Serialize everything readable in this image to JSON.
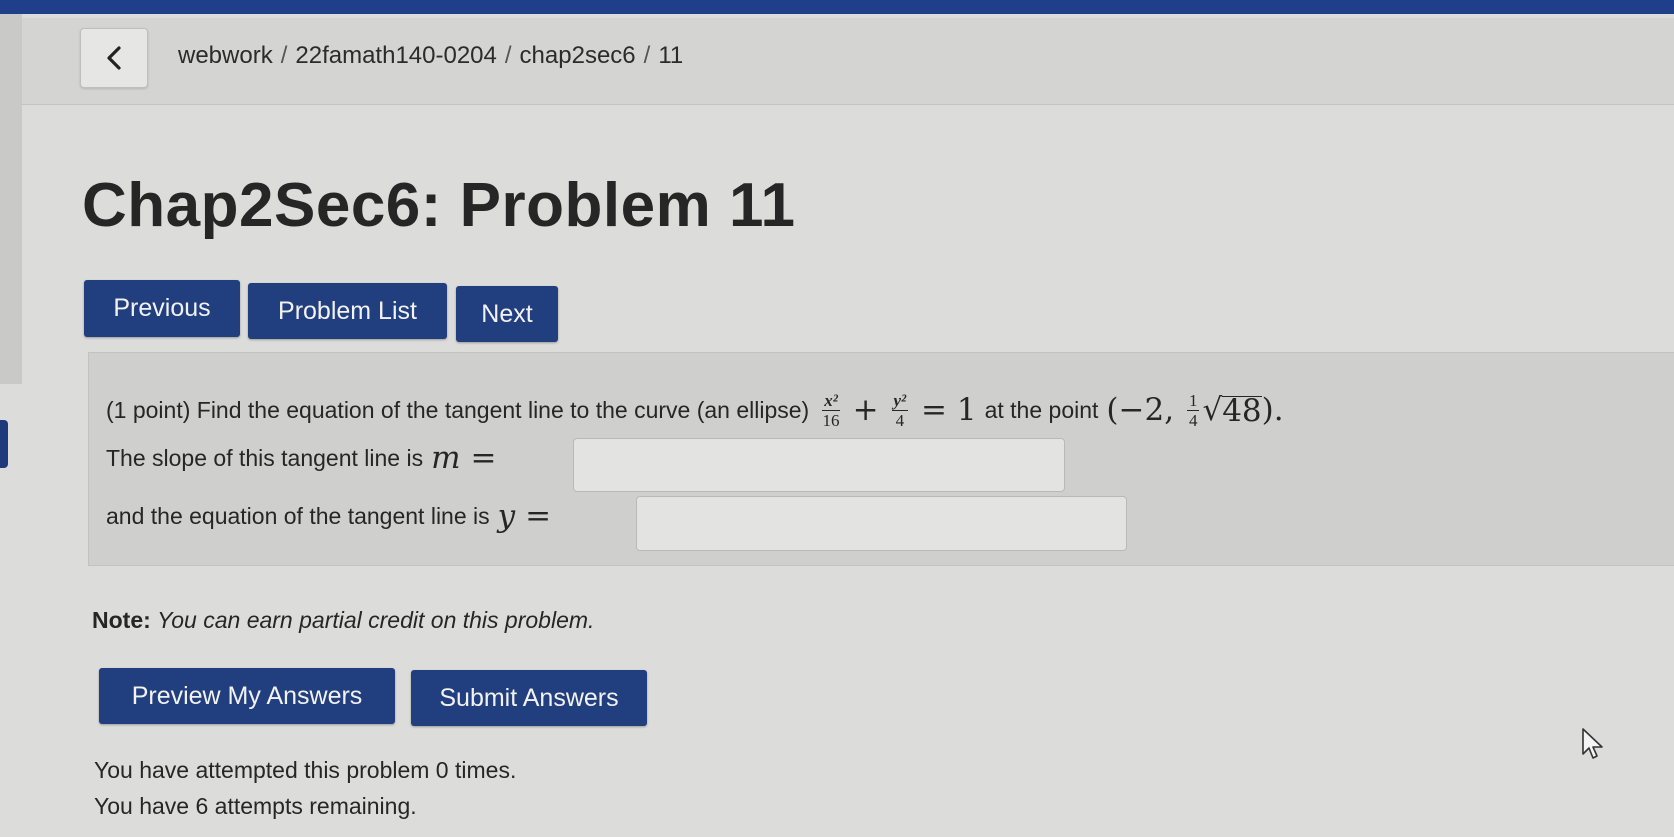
{
  "header": {
    "breadcrumb": [
      "webwork",
      "22famath140-0204",
      "chap2sec6",
      "11"
    ],
    "breadcrumb_separator": "/"
  },
  "page_title": "Chap2Sec6: Problem 11",
  "nav_buttons": {
    "previous": "Previous",
    "problem_list": "Problem List",
    "next": "Next"
  },
  "problem": {
    "intro": "(1 point) Find the equation of the tangent line to the curve (an ellipse)",
    "at_the_point": "at the point",
    "slope_label": "The slope of this tangent line is",
    "slope_var": "m",
    "slope_value": "",
    "equation_label": "and the equation of the tangent line is",
    "equation_var": "y",
    "equation_value": "",
    "equals": "=",
    "ellipse": {
      "x_term_num": "x²",
      "x_term_den": "16",
      "y_term_num": "y²",
      "y_term_den": "4",
      "rhs": "1"
    },
    "point": {
      "x": "−2",
      "coef_num": "1",
      "coef_den": "4",
      "radicand": "48"
    }
  },
  "note": {
    "label": "Note:",
    "text": "You can earn partial credit on this problem."
  },
  "action_buttons": {
    "preview": "Preview My Answers",
    "submit": "Submit Answers"
  },
  "status": {
    "attempted": "You have attempted this problem 0 times.",
    "remaining": "You have 6 attempts remaining."
  },
  "colors": {
    "button_bg": "#213f7e",
    "top_bar": "#1f3f8a",
    "page_bg": "#dcdddb"
  }
}
